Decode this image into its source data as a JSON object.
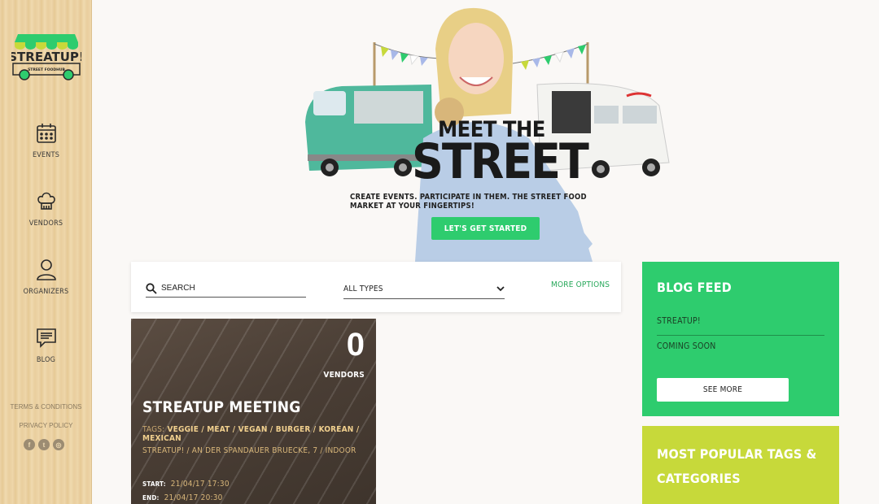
{
  "brand": {
    "name": "STREATUP!",
    "sub": "STREET FOODHUB"
  },
  "sidebar": {
    "items": [
      {
        "label": "EVENTS",
        "icon": "calendar-icon"
      },
      {
        "label": "VENDORS",
        "icon": "chef-hat-icon"
      },
      {
        "label": "ORGANIZERS",
        "icon": "person-icon"
      },
      {
        "label": "BLOG",
        "icon": "chat-icon"
      }
    ],
    "terms": "TERMS & CONDITIONS",
    "privacy": "PRIVACY POLICY",
    "social": [
      "facebook-icon",
      "twitter-icon",
      "instagram-icon"
    ]
  },
  "hero": {
    "title_line1": "MEET THE",
    "title_line2": "STREET",
    "tagline": "CREATE EVENTS. PARTICIPATE IN THEM. THE STREET FOOD MARKET AT YOUR FINGERTIPS!",
    "cta": "LET'S GET STARTED"
  },
  "search": {
    "placeholder": "SEARCH",
    "type_value": "ALL TYPES",
    "more_options": "MORE OPTIONS"
  },
  "event": {
    "vendor_count": "0",
    "vendor_label": "VENDORS",
    "title": "STREATUP MEETING",
    "tags_label": "TAGS:",
    "tags": "VEGGIE / MEAT / VEGAN / BURGER / KOREAN / MEXICAN",
    "location": "STREATUP! / AN DER SPANDAUER BRUECKE, 7 / INDOOR",
    "start_label": "START:",
    "start": "21/04/17 17:30",
    "end_label": "END:",
    "end": "21/04/17 20:30"
  },
  "blog": {
    "title": "BLOG FEED",
    "items": [
      "STREATUP!",
      "COMING SOON"
    ],
    "see_more": "SEE MORE"
  },
  "tags_box": {
    "title": "MOST POPULAR TAGS & CATEGORIES"
  },
  "colors": {
    "green": "#2ecc6e",
    "lime": "#c7d93a",
    "wood": "#ecd3a7"
  }
}
